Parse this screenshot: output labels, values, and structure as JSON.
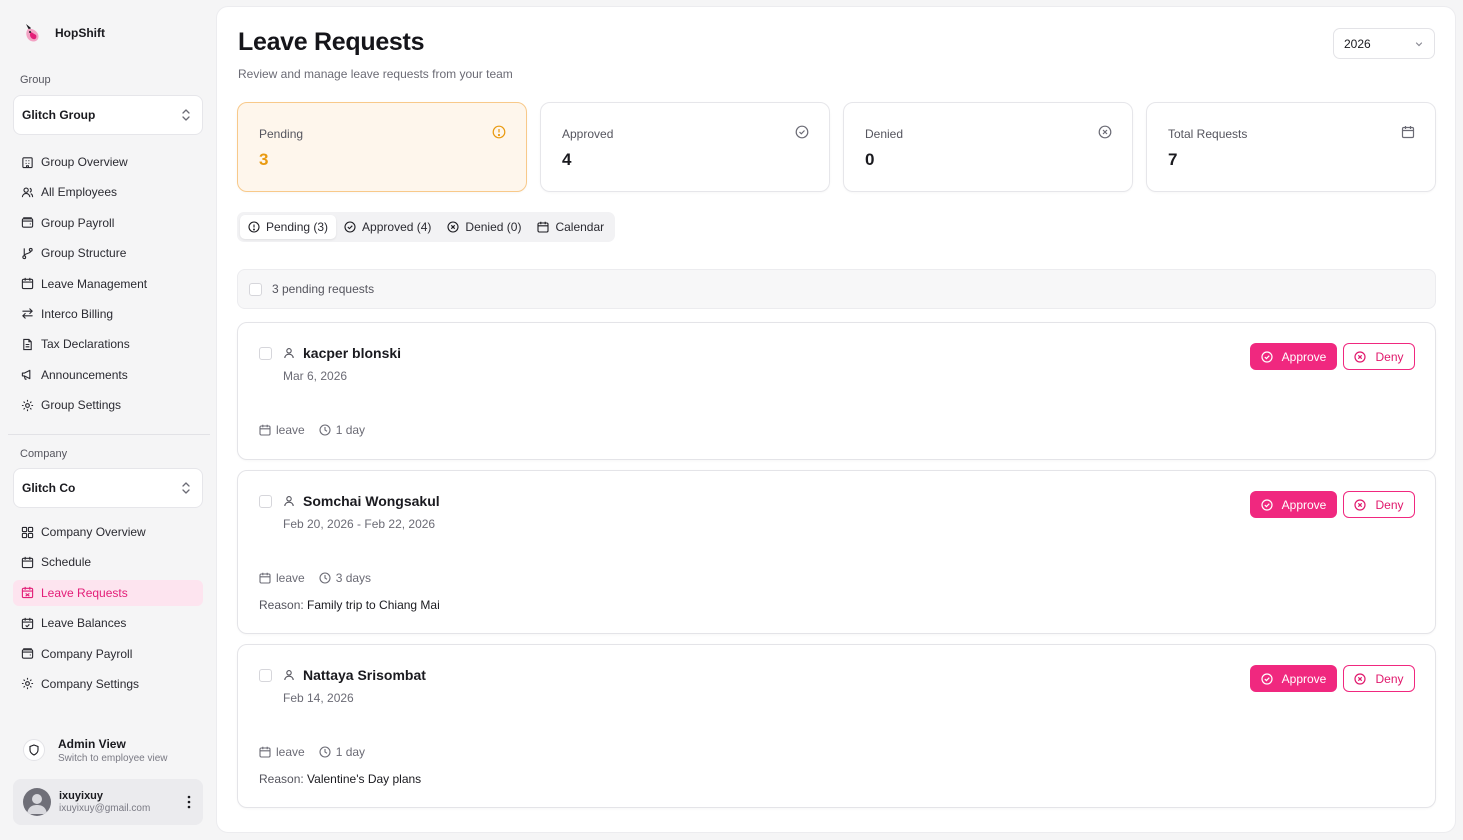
{
  "app": {
    "name": "HopShift"
  },
  "sidebar": {
    "group_label": "Group",
    "group_selector": "Glitch Group",
    "group_items": [
      {
        "label": "Group Overview",
        "icon": "building-icon"
      },
      {
        "label": "All Employees",
        "icon": "users-icon"
      },
      {
        "label": "Group Payroll",
        "icon": "wallet-icon"
      },
      {
        "label": "Group Structure",
        "icon": "git-branch-icon"
      },
      {
        "label": "Leave Management",
        "icon": "calendar-icon"
      },
      {
        "label": "Interco Billing",
        "icon": "arrows-swap-icon"
      },
      {
        "label": "Tax Declarations",
        "icon": "file-text-icon"
      },
      {
        "label": "Announcements",
        "icon": "megaphone-icon"
      },
      {
        "label": "Group Settings",
        "icon": "gear-icon"
      }
    ],
    "company_label": "Company",
    "company_selector": "Glitch Co",
    "company_items": [
      {
        "label": "Company Overview",
        "icon": "grid-icon"
      },
      {
        "label": "Schedule",
        "icon": "calendar-icon"
      },
      {
        "label": "Leave Requests",
        "icon": "calendar-off-icon",
        "active": true
      },
      {
        "label": "Leave Balances",
        "icon": "calendar-check-icon"
      },
      {
        "label": "Company Payroll",
        "icon": "wallet-icon"
      },
      {
        "label": "Company Settings",
        "icon": "gear-icon"
      }
    ],
    "admin": {
      "title": "Admin View",
      "subtitle": "Switch to employee view"
    },
    "user": {
      "name": "ixuyixuy",
      "email": "ixuyixuy@gmail.com"
    }
  },
  "header": {
    "title": "Leave Requests",
    "subtitle": "Review and manage leave requests from your team",
    "year": "2026"
  },
  "stats": {
    "pending": {
      "label": "Pending",
      "value": "3"
    },
    "approved": {
      "label": "Approved",
      "value": "4"
    },
    "denied": {
      "label": "Denied",
      "value": "0"
    },
    "total": {
      "label": "Total Requests",
      "value": "7"
    }
  },
  "tabs": {
    "pending": "Pending (3)",
    "approved": "Approved (4)",
    "denied": "Denied (0)",
    "calendar": "Calendar"
  },
  "bulk": {
    "text": "3 pending requests"
  },
  "buttons": {
    "approve": "Approve",
    "deny": "Deny"
  },
  "reason_label": "Reason:",
  "requests": [
    {
      "name": "kacper blonski",
      "date": "Mar 6, 2026",
      "type": "leave",
      "duration": "1 day",
      "reason": ""
    },
    {
      "name": "Somchai Wongsakul",
      "date": "Feb 20, 2026 - Feb 22, 2026",
      "type": "leave",
      "duration": "3 days",
      "reason": "Family trip to Chiang Mai"
    },
    {
      "name": "Nattaya Srisombat",
      "date": "Feb 14, 2026",
      "type": "leave",
      "duration": "1 day",
      "reason": "Valentine's Day plans"
    }
  ],
  "colors": {
    "accent": "#f0287f",
    "pending": "#e99a10",
    "active_nav_bg": "#fde4ef"
  }
}
